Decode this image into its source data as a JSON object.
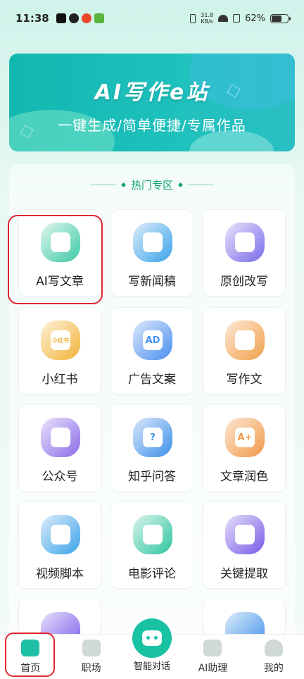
{
  "status_bar": {
    "time": "11:38",
    "speed_value": "31.8",
    "speed_unit": "KB/s",
    "battery": "62%"
  },
  "banner": {
    "title": "AI写作e站",
    "subtitle": "一键生成/简单便捷/专属作品"
  },
  "hot_section": {
    "title": "热门专区",
    "items": [
      {
        "label": "AI写文章",
        "icon": "document-icon",
        "color": "#3ec9a6",
        "bg": "#dff6ee"
      },
      {
        "label": "写新闻稿",
        "icon": "news-icon",
        "color": "#3aa3e8",
        "bg": "#dcecfb"
      },
      {
        "label": "原创改写",
        "icon": "edit-icon",
        "color": "#7a6ae8",
        "bg": "#e7e4fb"
      },
      {
        "label": "小红书",
        "icon": "xiaohongshu-icon",
        "color": "#f2b43a",
        "bg": "#fdf1d8",
        "badge": "小红书"
      },
      {
        "label": "广告文案",
        "icon": "ad-icon",
        "color": "#4a8ff0",
        "bg": "#dde8fc",
        "badge": "AD"
      },
      {
        "label": "写作文",
        "icon": "pen-icon",
        "color": "#f0a04a",
        "bg": "#fde9d6"
      },
      {
        "label": "公众号",
        "icon": "badge-icon",
        "color": "#8a6ae8",
        "bg": "#e9e3fb"
      },
      {
        "label": "知乎问答",
        "icon": "question-icon",
        "color": "#3c8fe8",
        "bg": "#dbe8fb",
        "badge": "?"
      },
      {
        "label": "文章润色",
        "icon": "polish-icon",
        "color": "#f09a4a",
        "bg": "#fde6d2",
        "badge": "A+"
      },
      {
        "label": "视频脚本",
        "icon": "video-icon",
        "color": "#3aa3e8",
        "bg": "#dcecfb"
      },
      {
        "label": "电影评论",
        "icon": "comment-icon",
        "color": "#2fc4a0",
        "bg": "#d9f5ec"
      },
      {
        "label": "关键提取",
        "icon": "target-icon",
        "color": "#7a5ae8",
        "bg": "#e6e0fb"
      }
    ]
  },
  "bottom_nav": {
    "items": [
      {
        "label": "首页",
        "icon": "home-icon"
      },
      {
        "label": "职场",
        "icon": "briefcase-icon"
      },
      {
        "label": "智能对话",
        "icon": "robot-icon"
      },
      {
        "label": "AI助理",
        "icon": "assistant-icon"
      },
      {
        "label": "我的",
        "icon": "user-icon"
      }
    ]
  }
}
